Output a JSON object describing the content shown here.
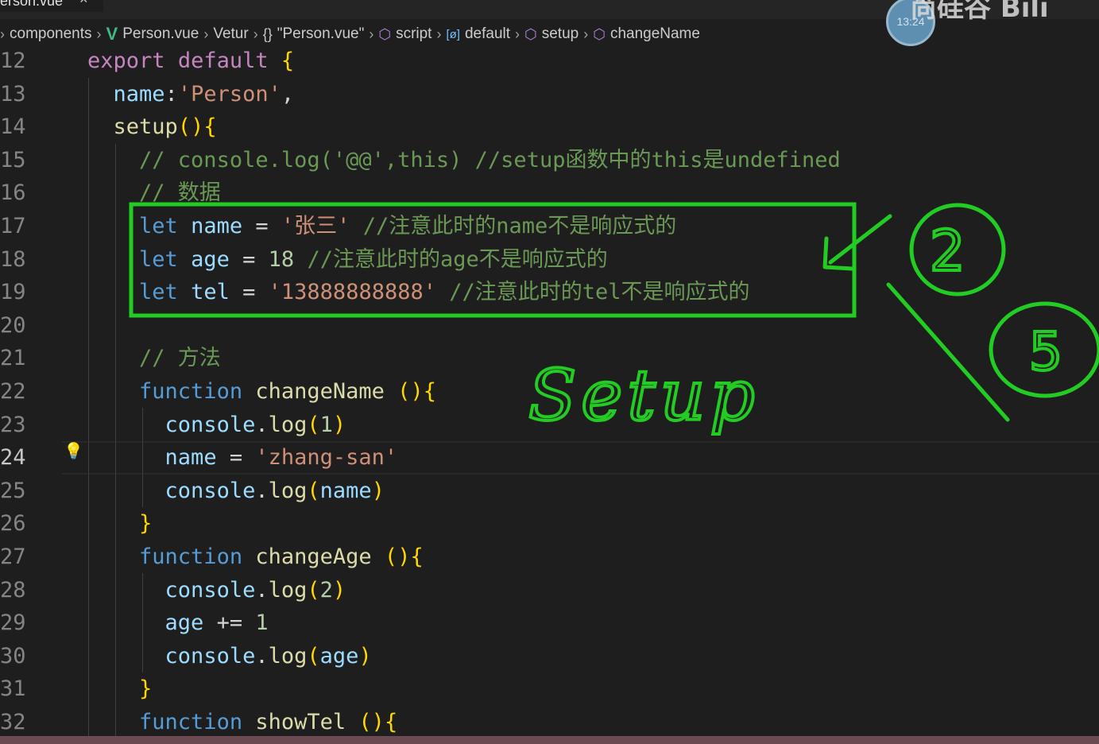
{
  "tab": {
    "label": "erson.vue",
    "close": "×"
  },
  "breadcrumbs": [
    {
      "icon": "",
      "label": "components"
    },
    {
      "icon": "V",
      "label": "Person.vue"
    },
    {
      "icon": "",
      "label": "Vetur"
    },
    {
      "icon": "{}",
      "label": "\"Person.vue\""
    },
    {
      "icon": "⬡",
      "label": "script"
    },
    {
      "icon": "[ø]",
      "label": "default"
    },
    {
      "icon": "⬡",
      "label": "setup"
    },
    {
      "icon": "⬡",
      "label": "changeName"
    }
  ],
  "overlay": {
    "timestamp": "13:24",
    "watermark": "尚硅谷 Bili",
    "handwriting_text": "Setup",
    "circle_labels": [
      "2",
      "5"
    ],
    "annotation_color": "#22cc22"
  },
  "editor": {
    "active_line": 24,
    "lines": [
      {
        "num": "12",
        "text": "export default {"
      },
      {
        "num": "13",
        "text": "  name:'Person',"
      },
      {
        "num": "14",
        "text": "  setup(){"
      },
      {
        "num": "15",
        "text": "    // console.log('@@',this) //setup函数中的this是undefined"
      },
      {
        "num": "16",
        "text": "    // 数据"
      },
      {
        "num": "17",
        "text": "    let name = '张三' //注意此时的name不是响应式的"
      },
      {
        "num": "18",
        "text": "    let age = 18 //注意此时的age不是响应式的"
      },
      {
        "num": "19",
        "text": "    let tel = '13888888888' //注意此时的tel不是响应式的"
      },
      {
        "num": "20",
        "text": ""
      },
      {
        "num": "21",
        "text": "    // 方法"
      },
      {
        "num": "22",
        "text": "    function changeName (){"
      },
      {
        "num": "23",
        "text": "      console.log(1)"
      },
      {
        "num": "24",
        "text": "      name = 'zhang-san'"
      },
      {
        "num": "25",
        "text": "      console.log(name)"
      },
      {
        "num": "26",
        "text": "    }"
      },
      {
        "num": "27",
        "text": "    function changeAge (){"
      },
      {
        "num": "28",
        "text": "      console.log(2)"
      },
      {
        "num": "29",
        "text": "      age += 1"
      },
      {
        "num": "30",
        "text": "      console.log(age)"
      },
      {
        "num": "31",
        "text": "    }"
      },
      {
        "num": "32",
        "text": "    function showTel (){"
      }
    ]
  },
  "colors": {
    "background": "#1e1e1e",
    "keyword": "#c586c0",
    "declaration": "#569cd6",
    "function": "#dcdcaa",
    "variable": "#9cdcfe",
    "string": "#ce9178",
    "number": "#b5cea8",
    "comment": "#6a9955",
    "annotation": "#22cc22"
  }
}
